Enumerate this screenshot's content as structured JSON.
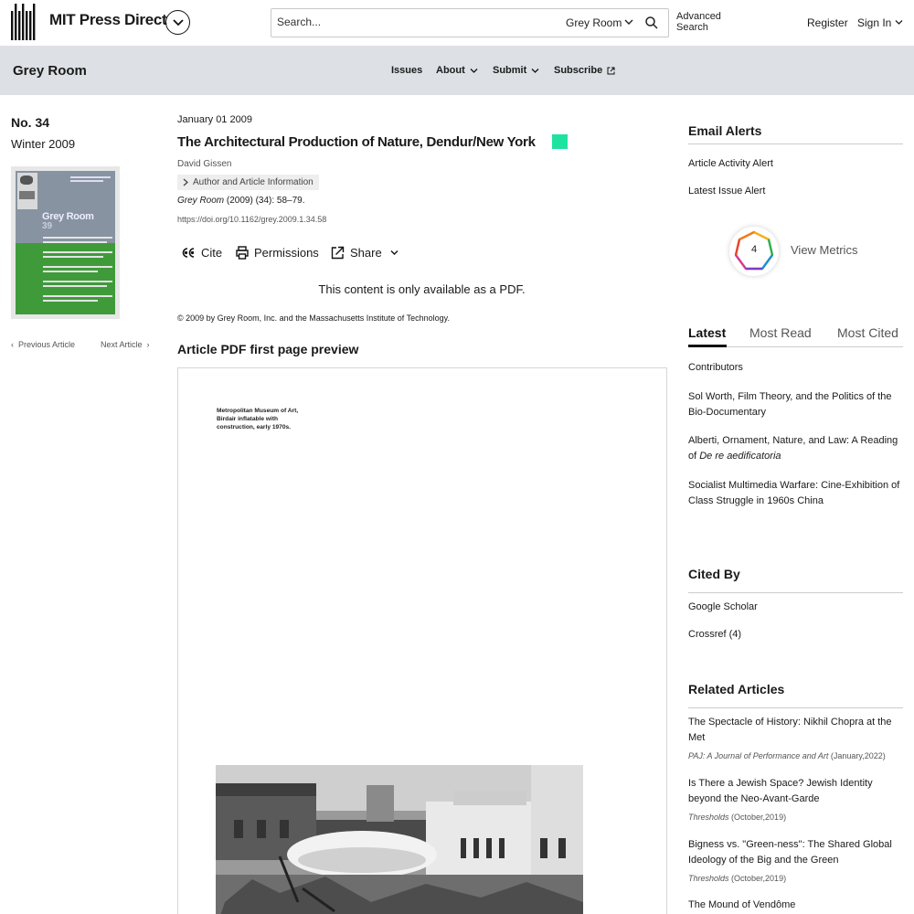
{
  "header": {
    "brand": "MIT Press Direct",
    "search_placeholder": "Search...",
    "search_scope": "Grey Room",
    "advanced_search": "Advanced Search",
    "register": "Register",
    "sign_in": "Sign In"
  },
  "journal": {
    "title": "Grey Room",
    "nav": [
      {
        "label": "Issues"
      },
      {
        "label": "About"
      },
      {
        "label": "Submit"
      },
      {
        "label": "Subscribe"
      }
    ]
  },
  "issue": {
    "number": "No. 34",
    "season": "Winter 2009",
    "cover_title": "Grey Room",
    "cover_number": "39",
    "prev_article": "Previous Article",
    "next_article": "Next Article"
  },
  "article": {
    "date": "January 01 2009",
    "title": "The Architectural Production of Nature, Dendur/New York",
    "author": "David Gissen",
    "author_info": "Author and Article Information",
    "citation_journal": "Grey Room",
    "citation_rest": " (2009) (34): 58–79.",
    "doi": "https://doi.org/10.1162/grey.2009.1.34.58",
    "tools": {
      "cite": "Cite",
      "permissions": "Permissions",
      "share": "Share"
    },
    "pdf_only": "This content is only available as a PDF.",
    "copyright": "© 2009 by Grey Room, Inc. and the Massachusetts Institute of Technology.",
    "preview_heading": "Article PDF first page preview",
    "pdf_caption": "Metropolitan Museum of Art, Birdair inflatable with construction, early 1970s."
  },
  "sidebar": {
    "email_alerts": {
      "heading": "Email Alerts",
      "items": [
        "Article Activity Alert",
        "Latest Issue Alert"
      ]
    },
    "metrics": {
      "count": "4",
      "label": "View Metrics"
    },
    "tabs": [
      "Latest",
      "Most Read",
      "Most Cited"
    ],
    "latest": [
      "Contributors",
      "Sol Worth, Film Theory, and the Politics of the Bio-Documentary",
      {
        "text": "Alberti, Ornament, Nature, and Law: A Reading of ",
        "italic": "De re aedificatoria"
      },
      "Socialist Multimedia Warfare: Cine-Exhibition of Class Struggle in 1960s China"
    ],
    "cited_by": {
      "heading": "Cited By",
      "items": [
        "Google Scholar",
        "Crossref (4)"
      ]
    },
    "related": {
      "heading": "Related Articles",
      "items": [
        {
          "title": "The Spectacle of History: Nikhil Chopra at the Met",
          "source": "PAJ: A Journal of Performance and Art",
          "date": " (January,2022)"
        },
        {
          "title": "Is There a Jewish Space? Jewish Identity beyond the Neo-Avant-Garde",
          "source": "Thresholds",
          "date": " (October,2019)"
        },
        {
          "title": "Bigness vs. \"Green-ness\": The Shared Global Ideology of the Big and the Green",
          "source": "Thresholds",
          "date": " (October,2019)"
        },
        {
          "title": "The Mound of Vendôme"
        }
      ]
    }
  }
}
